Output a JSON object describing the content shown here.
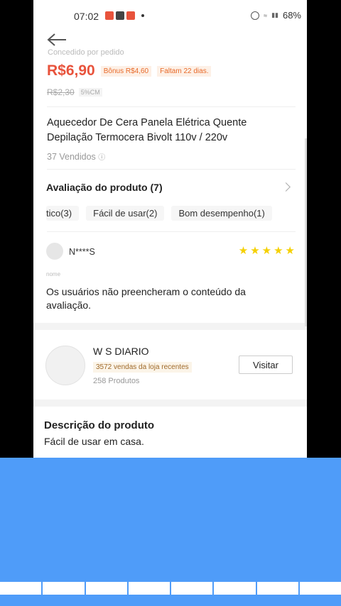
{
  "status_bar": {
    "time": "07:02",
    "battery": "68%"
  },
  "product": {
    "cut_label": "Concedido por pedido",
    "price": "R$6,90",
    "bonus": "Bônus R$4,60",
    "deadline": "Faltam 22 dias.",
    "old_price": "R$2,30",
    "discount": "5%CM",
    "title": "Aquecedor De Cera Panela Elétrica Quente Depilação Termocera Bivolt 110v / 220v",
    "sold": "37 Vendidos"
  },
  "reviews": {
    "heading": "Avaliação do produto (7)",
    "tags": [
      "tico(3)",
      "Fácil de usar(2)",
      "Bom desempenho(1)"
    ],
    "item": {
      "user": "N****S",
      "rating": 5,
      "variant_label": "nome",
      "text": "Os usuários não preencheram o conteúdo da avaliação."
    }
  },
  "shop": {
    "name": "W S DIARIO",
    "sales": "3572 vendas da loja recentes",
    "products": "258 Produtos",
    "visit_label": "Visitar"
  },
  "description": {
    "heading": "Descrição do produto",
    "text": "Fácil de usar em casa."
  },
  "colors": {
    "accent": "#e8533c",
    "overlay": "#4f9cf9",
    "star": "#f5d000"
  }
}
